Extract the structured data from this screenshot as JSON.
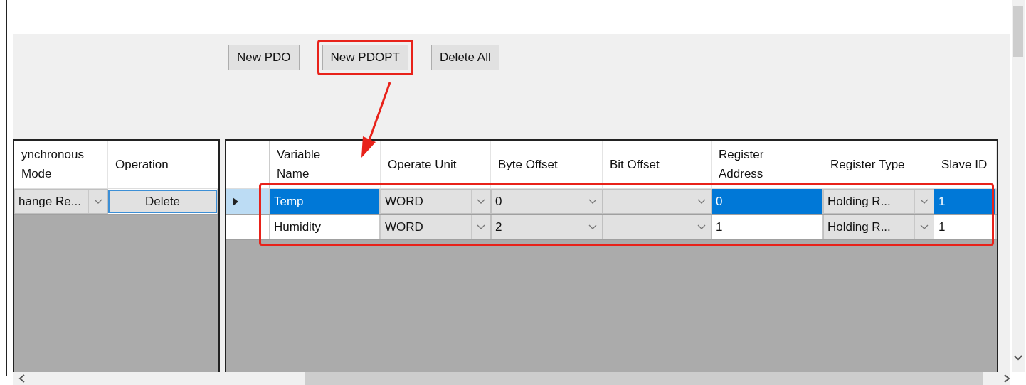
{
  "toolbar": {
    "buttons": [
      {
        "label": "New PDO",
        "highlighted": false
      },
      {
        "label": "New PDOPT",
        "highlighted": true
      },
      {
        "label": "Delete All",
        "highlighted": false
      }
    ]
  },
  "grids": [
    {
      "columns": [
        {
          "label": "ynchronous Mode"
        },
        {
          "label": "Operation"
        }
      ],
      "rows": [
        {
          "cells": [
            {
              "kind": "combo",
              "value": "hange Re..."
            },
            {
              "kind": "button",
              "value": "Delete",
              "focused": true
            }
          ]
        }
      ]
    },
    {
      "columns": [
        {
          "label": "Variable Name"
        },
        {
          "label": "Operate Unit"
        },
        {
          "label": "Byte Offset"
        },
        {
          "label": "Bit Offset"
        },
        {
          "label": "Register Address"
        },
        {
          "label": "Register Type"
        },
        {
          "label": "Slave ID"
        }
      ],
      "row_header": true,
      "rows": [
        {
          "selected": true,
          "highlighted": true,
          "cells": [
            {
              "kind": "text",
              "value": "Temp"
            },
            {
              "kind": "combo",
              "value": "WORD"
            },
            {
              "kind": "combo",
              "value": "0"
            },
            {
              "kind": "combo"
            },
            {
              "kind": "text",
              "value": "0"
            },
            {
              "kind": "combo",
              "value": "Holding R..."
            },
            {
              "kind": "text",
              "value": "1"
            }
          ]
        },
        {
          "selected": false,
          "highlighted": true,
          "cells": [
            {
              "kind": "text",
              "value": "Humidity"
            },
            {
              "kind": "combo",
              "value": "WORD"
            },
            {
              "kind": "combo",
              "value": "2"
            },
            {
              "kind": "combo"
            },
            {
              "kind": "text",
              "value": "1"
            },
            {
              "kind": "combo",
              "value": "Holding R..."
            },
            {
              "kind": "text",
              "value": "1"
            }
          ]
        }
      ]
    }
  ]
}
